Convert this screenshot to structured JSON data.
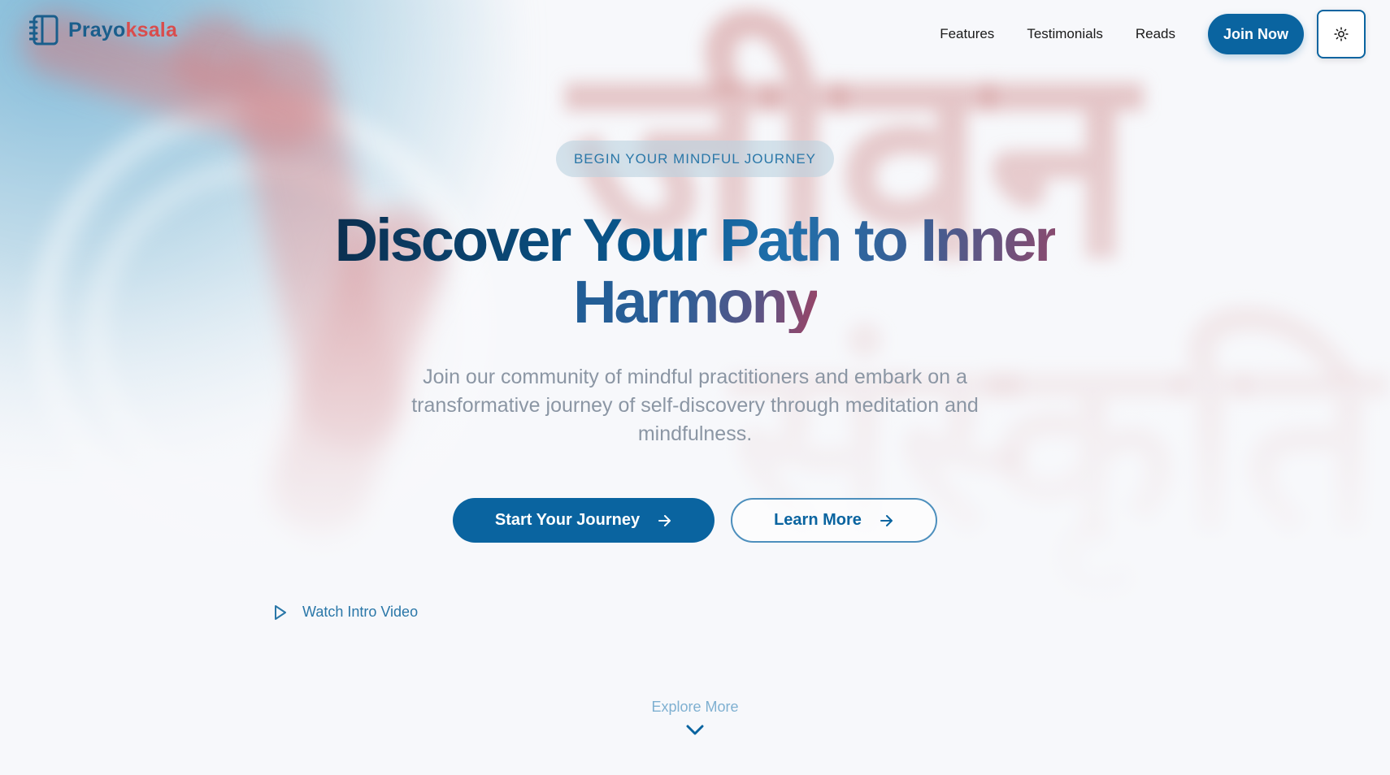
{
  "brand": {
    "name_part1": "Prayo",
    "name_part2": "ksala",
    "icon": "notebook-icon",
    "colors": {
      "primary": "#1a5e8c",
      "accent": "#d94d4d"
    }
  },
  "nav": {
    "links": [
      "Features",
      "Testimonials",
      "Reads"
    ],
    "join_label": "Join Now",
    "theme_icon": "sun-icon"
  },
  "hero": {
    "badge": "BEGIN YOUR MINDFUL JOURNEY",
    "headline_line1": "Discover Your Path to Inner",
    "headline_line2": "Harmony",
    "subtitle": "Join our community of mindful practitioners and embark on a transformative journey of self-discovery through meditation and mindfulness.",
    "primary_cta": "Start Your Journey",
    "secondary_cta": "Learn More",
    "cta_icon": "arrow-right-icon",
    "watch_video": "Watch Intro Video",
    "watch_icon": "play-icon",
    "explore": "Explore More",
    "explore_icon": "chevron-down-icon"
  },
  "colors": {
    "primary_blue": "#0a64a0",
    "text_muted": "#8b96a4",
    "link_blue": "#2a77a8",
    "background": "#f7f8fb"
  }
}
